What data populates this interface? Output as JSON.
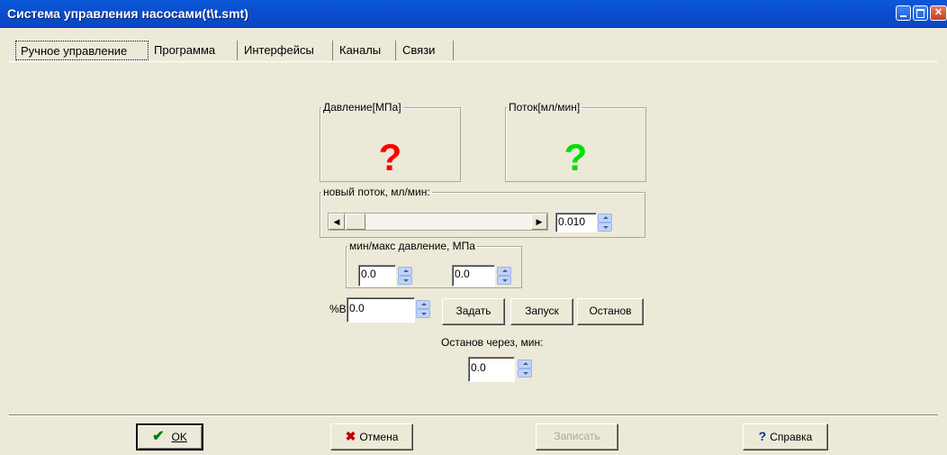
{
  "window": {
    "title": "Система управления насосами(t\\t.smt)"
  },
  "tabs": [
    {
      "label": "Ручное управление",
      "active": true
    },
    {
      "label": "Программа",
      "active": false
    },
    {
      "label": "Интерфейсы",
      "active": false
    },
    {
      "label": "Каналы",
      "active": false
    },
    {
      "label": "Связи",
      "active": false
    }
  ],
  "pressure": {
    "label": "Давление[МПа]",
    "value": "?",
    "color": "#ff0000"
  },
  "flow": {
    "label": "Поток[мл/мин]",
    "value": "?",
    "color": "#00e000"
  },
  "new_flow": {
    "label": "новый поток, мл/мин:",
    "value": "0.010"
  },
  "minmax": {
    "label": "мин/макс давление, МПа",
    "min": "0.0",
    "max": "0.0"
  },
  "percent_b": {
    "label": "%B",
    "value": "0.0"
  },
  "buttons": {
    "set": "Задать",
    "start": "Запуск",
    "stop": "Останов",
    "ok": "OK",
    "cancel": "Отмена",
    "write": "Записать",
    "help": "Справка"
  },
  "stop_after": {
    "label": "Останов через, мин:",
    "value": "0.0"
  },
  "icons": {
    "ok": "checkmark-icon",
    "cancel": "x-icon",
    "help": "question-icon"
  }
}
